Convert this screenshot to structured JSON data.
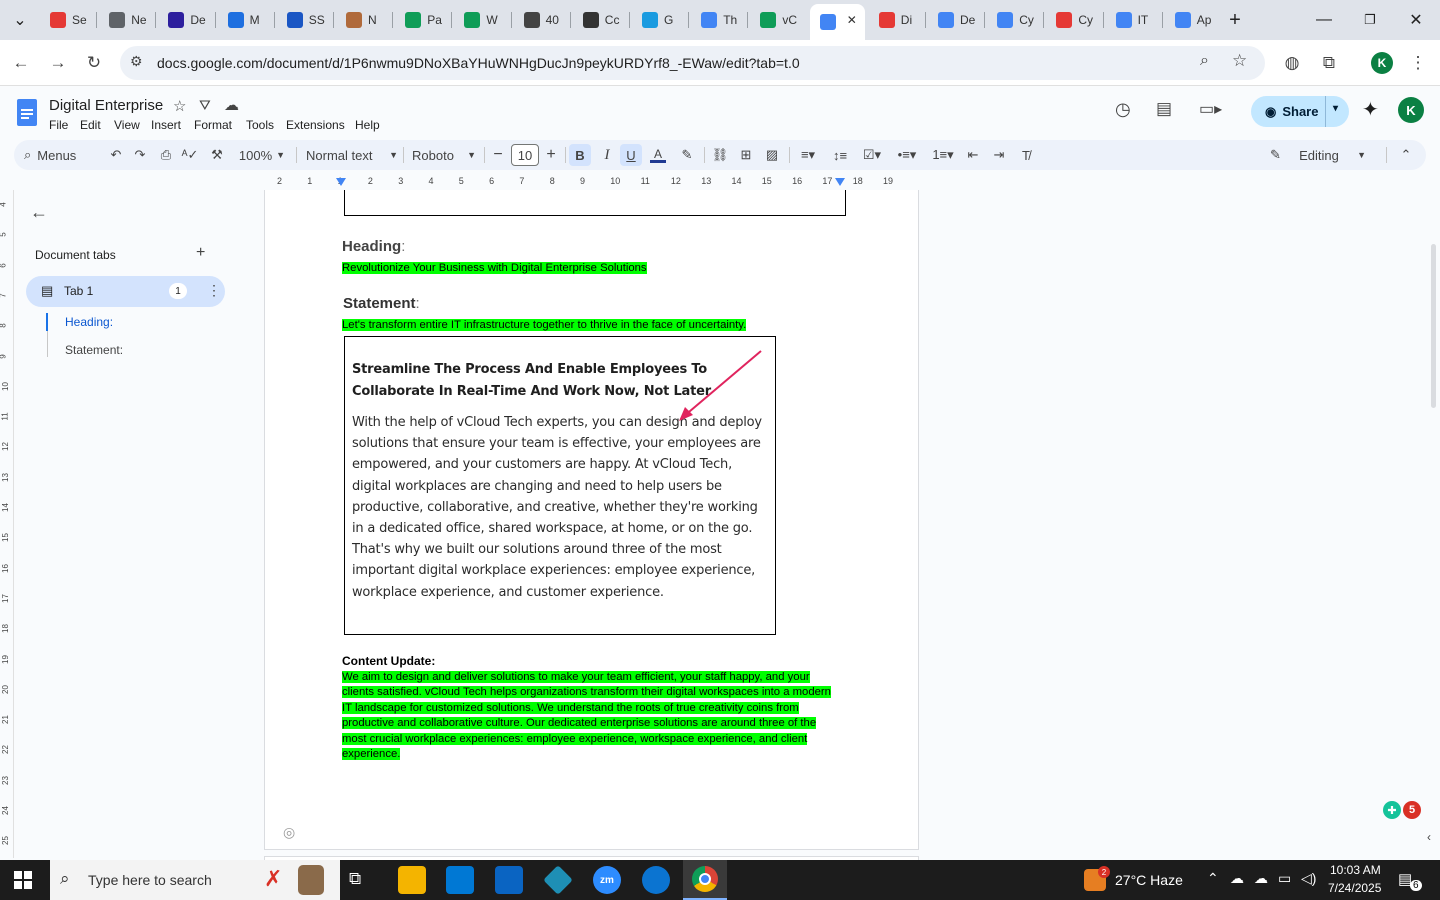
{
  "browser": {
    "tabs": [
      {
        "label": "Se",
        "color": "#e53935"
      },
      {
        "label": "Ne",
        "color": "#5f6368"
      },
      {
        "label": "De",
        "color": "#2d1f9e"
      },
      {
        "label": "M",
        "color": "#1e6fe0"
      },
      {
        "label": "SS",
        "color": "#1a56c4"
      },
      {
        "label": "N",
        "color": "#b06a3b"
      },
      {
        "label": "Pa",
        "color": "#0f9d58"
      },
      {
        "label": "W",
        "color": "#0f9d58"
      },
      {
        "label": "40",
        "color": "#444444"
      },
      {
        "label": "Cc",
        "color": "#333333"
      },
      {
        "label": "G",
        "color": "#1a9be0"
      },
      {
        "label": "Th",
        "color": "#4285f4"
      },
      {
        "label": "vC",
        "color": "#0f9d58"
      },
      {
        "label": "",
        "color": "#4285f4"
      },
      {
        "label": "Di",
        "color": "#e53935"
      },
      {
        "label": "De",
        "color": "#4285f4"
      },
      {
        "label": "Cy",
        "color": "#4285f4"
      },
      {
        "label": "Cy",
        "color": "#e53935"
      },
      {
        "label": "IT",
        "color": "#4285f4"
      },
      {
        "label": "Ap",
        "color": "#4285f4"
      }
    ],
    "url": "docs.google.com/document/d/1P6nwmu9DNoXBaYHuWNHgDucJn9peykURDYrf8_-EWaw/edit?tab=t.0",
    "profile_initial": "K"
  },
  "docs": {
    "title": "Digital Enterprise",
    "menu": [
      "File",
      "Edit",
      "View",
      "Insert",
      "Format",
      "Tools",
      "Extensions",
      "Help"
    ],
    "share_label": "Share",
    "user_initial": "K",
    "toolbar": {
      "menus_label": "Menus",
      "zoom": "100%",
      "style": "Normal text",
      "font": "Roboto",
      "font_size": "10",
      "mode": "Editing"
    },
    "ruler_numbers": [
      "2",
      "1",
      "1",
      "2",
      "3",
      "4",
      "5",
      "6",
      "7",
      "8",
      "9",
      "10",
      "11",
      "12",
      "13",
      "14",
      "15",
      "16",
      "17",
      "18",
      "19"
    ],
    "vruler_numbers": [
      "4",
      "5",
      "6",
      "7",
      "8",
      "9",
      "10",
      "11",
      "12",
      "13",
      "14",
      "15",
      "16",
      "17",
      "18",
      "19",
      "20",
      "21",
      "22",
      "23",
      "24",
      "25"
    ]
  },
  "sidebar": {
    "title": "Document tabs",
    "tab_name": "Tab 1",
    "tab_badge": "1",
    "outline": [
      {
        "label": "Heading:",
        "active": true
      },
      {
        "label": "Statement:",
        "active": false
      }
    ]
  },
  "document": {
    "heading_label": "Heading",
    "heading_colon": ":",
    "heading_text": "Revolutionize Your Business with Digital Enterprise Solutions",
    "statement_label": "Statement",
    "statement_colon": ":",
    "statement_text": "Let's transform entire IT infrastructure together to thrive in the face of uncertainty.",
    "box_heading": "Streamline The Process And Enable Employees To Collaborate In Real-Time And Work Now, Not Later",
    "box_body": "With the help of vCloud Tech experts, you can design and deploy solutions that ensure your team is effective, your employees are empowered, and your customers are happy. At vCloud Tech, digital workplaces are changing and need to help users be productive, collaborative, and creative, whether they're working in a dedicated office, shared workspace, at home, or on the go. That's why we built our solutions around three of the most important digital workplace experiences: employee experience, workplace experience, and customer experience.",
    "content_update_label": "Content Update:",
    "content_update_text": "We aim to design and deliver solutions to make your team efficient, your staff happy, and your clients satisfied. vCloud Tech helps organizations transform their digital workspaces into a modern IT landscape for customized solutions. We understand the roots of true creativity coins from productive and collaborative culture. Our dedicated enterprise solutions are around three of the most crucial workplace experiences: employee experience, workspace experience, and client experience.",
    "highlight_color": "#00ff00"
  },
  "extension_badge": "5",
  "taskbar": {
    "search_placeholder": "Type here to search",
    "weather_badge": "2",
    "weather": "27°C  Haze",
    "time": "10:03 AM",
    "date": "7/24/2025",
    "notification_count": "6"
  }
}
